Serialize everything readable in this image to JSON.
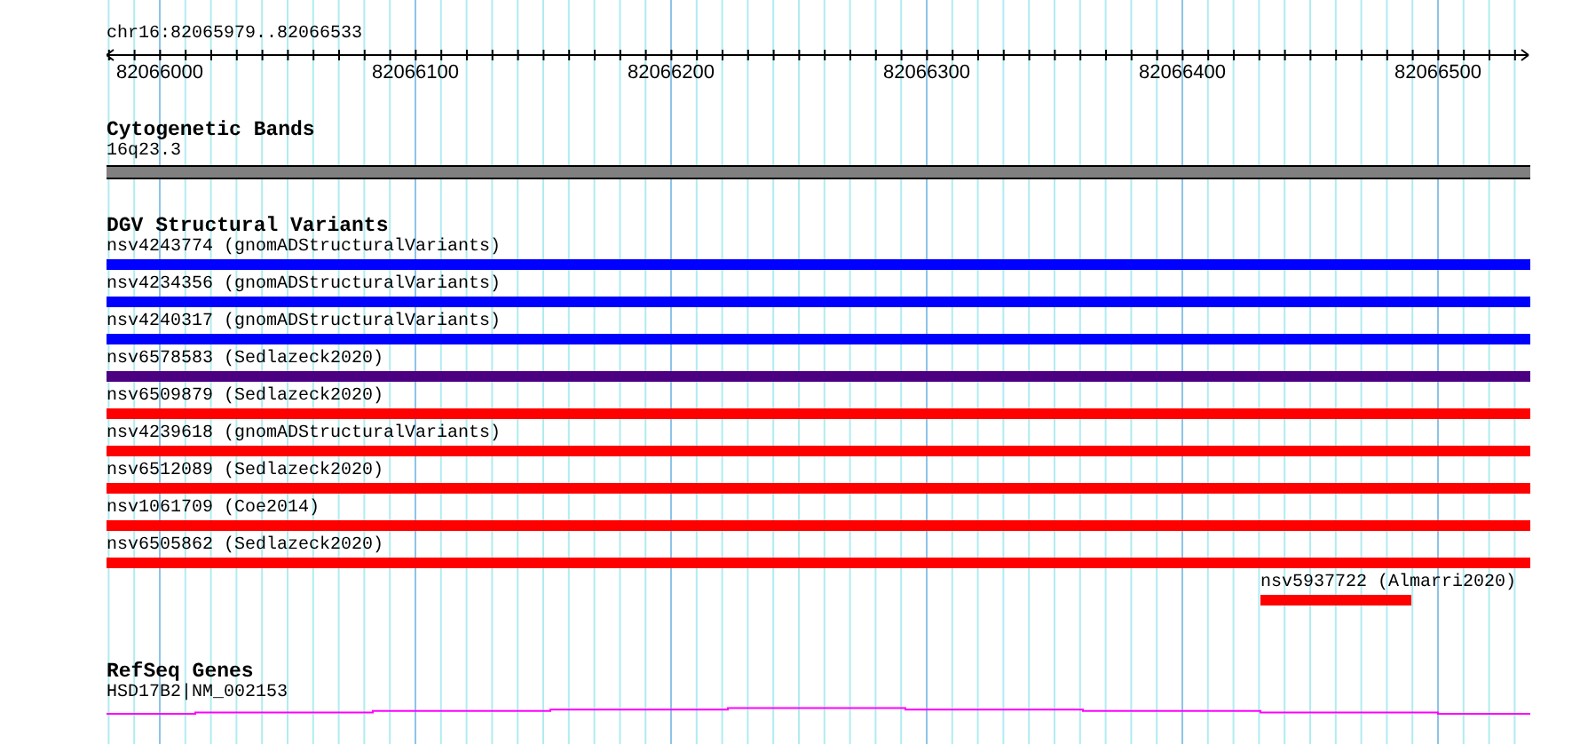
{
  "location": "chr16:82065979..82066533",
  "ruler": {
    "ticks": [
      "82066000",
      "82066100",
      "82066200",
      "82066300",
      "82066400",
      "82066500"
    ]
  },
  "tracks": [
    {
      "kind": "band",
      "title": "Cytogenetic Bands",
      "label": "16q23.3"
    },
    {
      "kind": "variants",
      "title": "DGV Structural Variants",
      "items": [
        {
          "label": "nsv4243774 (gnomADStructuralVariants)",
          "color": "#0000ff",
          "kind": "full"
        },
        {
          "label": "nsv4234356 (gnomADStructuralVariants)",
          "color": "#0000ff",
          "kind": "full"
        },
        {
          "label": "nsv4240317 (gnomADStructuralVariants)",
          "color": "#0000ff",
          "kind": "full"
        },
        {
          "label": "nsv6578583 (Sedlazeck2020)",
          "color": "#4b0082",
          "kind": "full"
        },
        {
          "label": "nsv6509879 (Sedlazeck2020)",
          "color": "#ff0000",
          "kind": "full"
        },
        {
          "label": "nsv4239618 (gnomADStructuralVariants)",
          "color": "#ff0000",
          "kind": "full"
        },
        {
          "label": "nsv6512089 (Sedlazeck2020)",
          "color": "#ff0000",
          "kind": "full"
        },
        {
          "label": "nsv1061709 (Coe2014)",
          "color": "#ff0000",
          "kind": "full"
        },
        {
          "label": "nsv6505862 (Sedlazeck2020)",
          "color": "#ff0000",
          "kind": "full"
        },
        {
          "label": "nsv5937722 (Almarri2020)",
          "color": "#ff0000",
          "kind": "partial"
        }
      ]
    },
    {
      "kind": "genes",
      "title": "RefSeq Genes",
      "label": "HSD17B2|NM_002153"
    }
  ]
}
